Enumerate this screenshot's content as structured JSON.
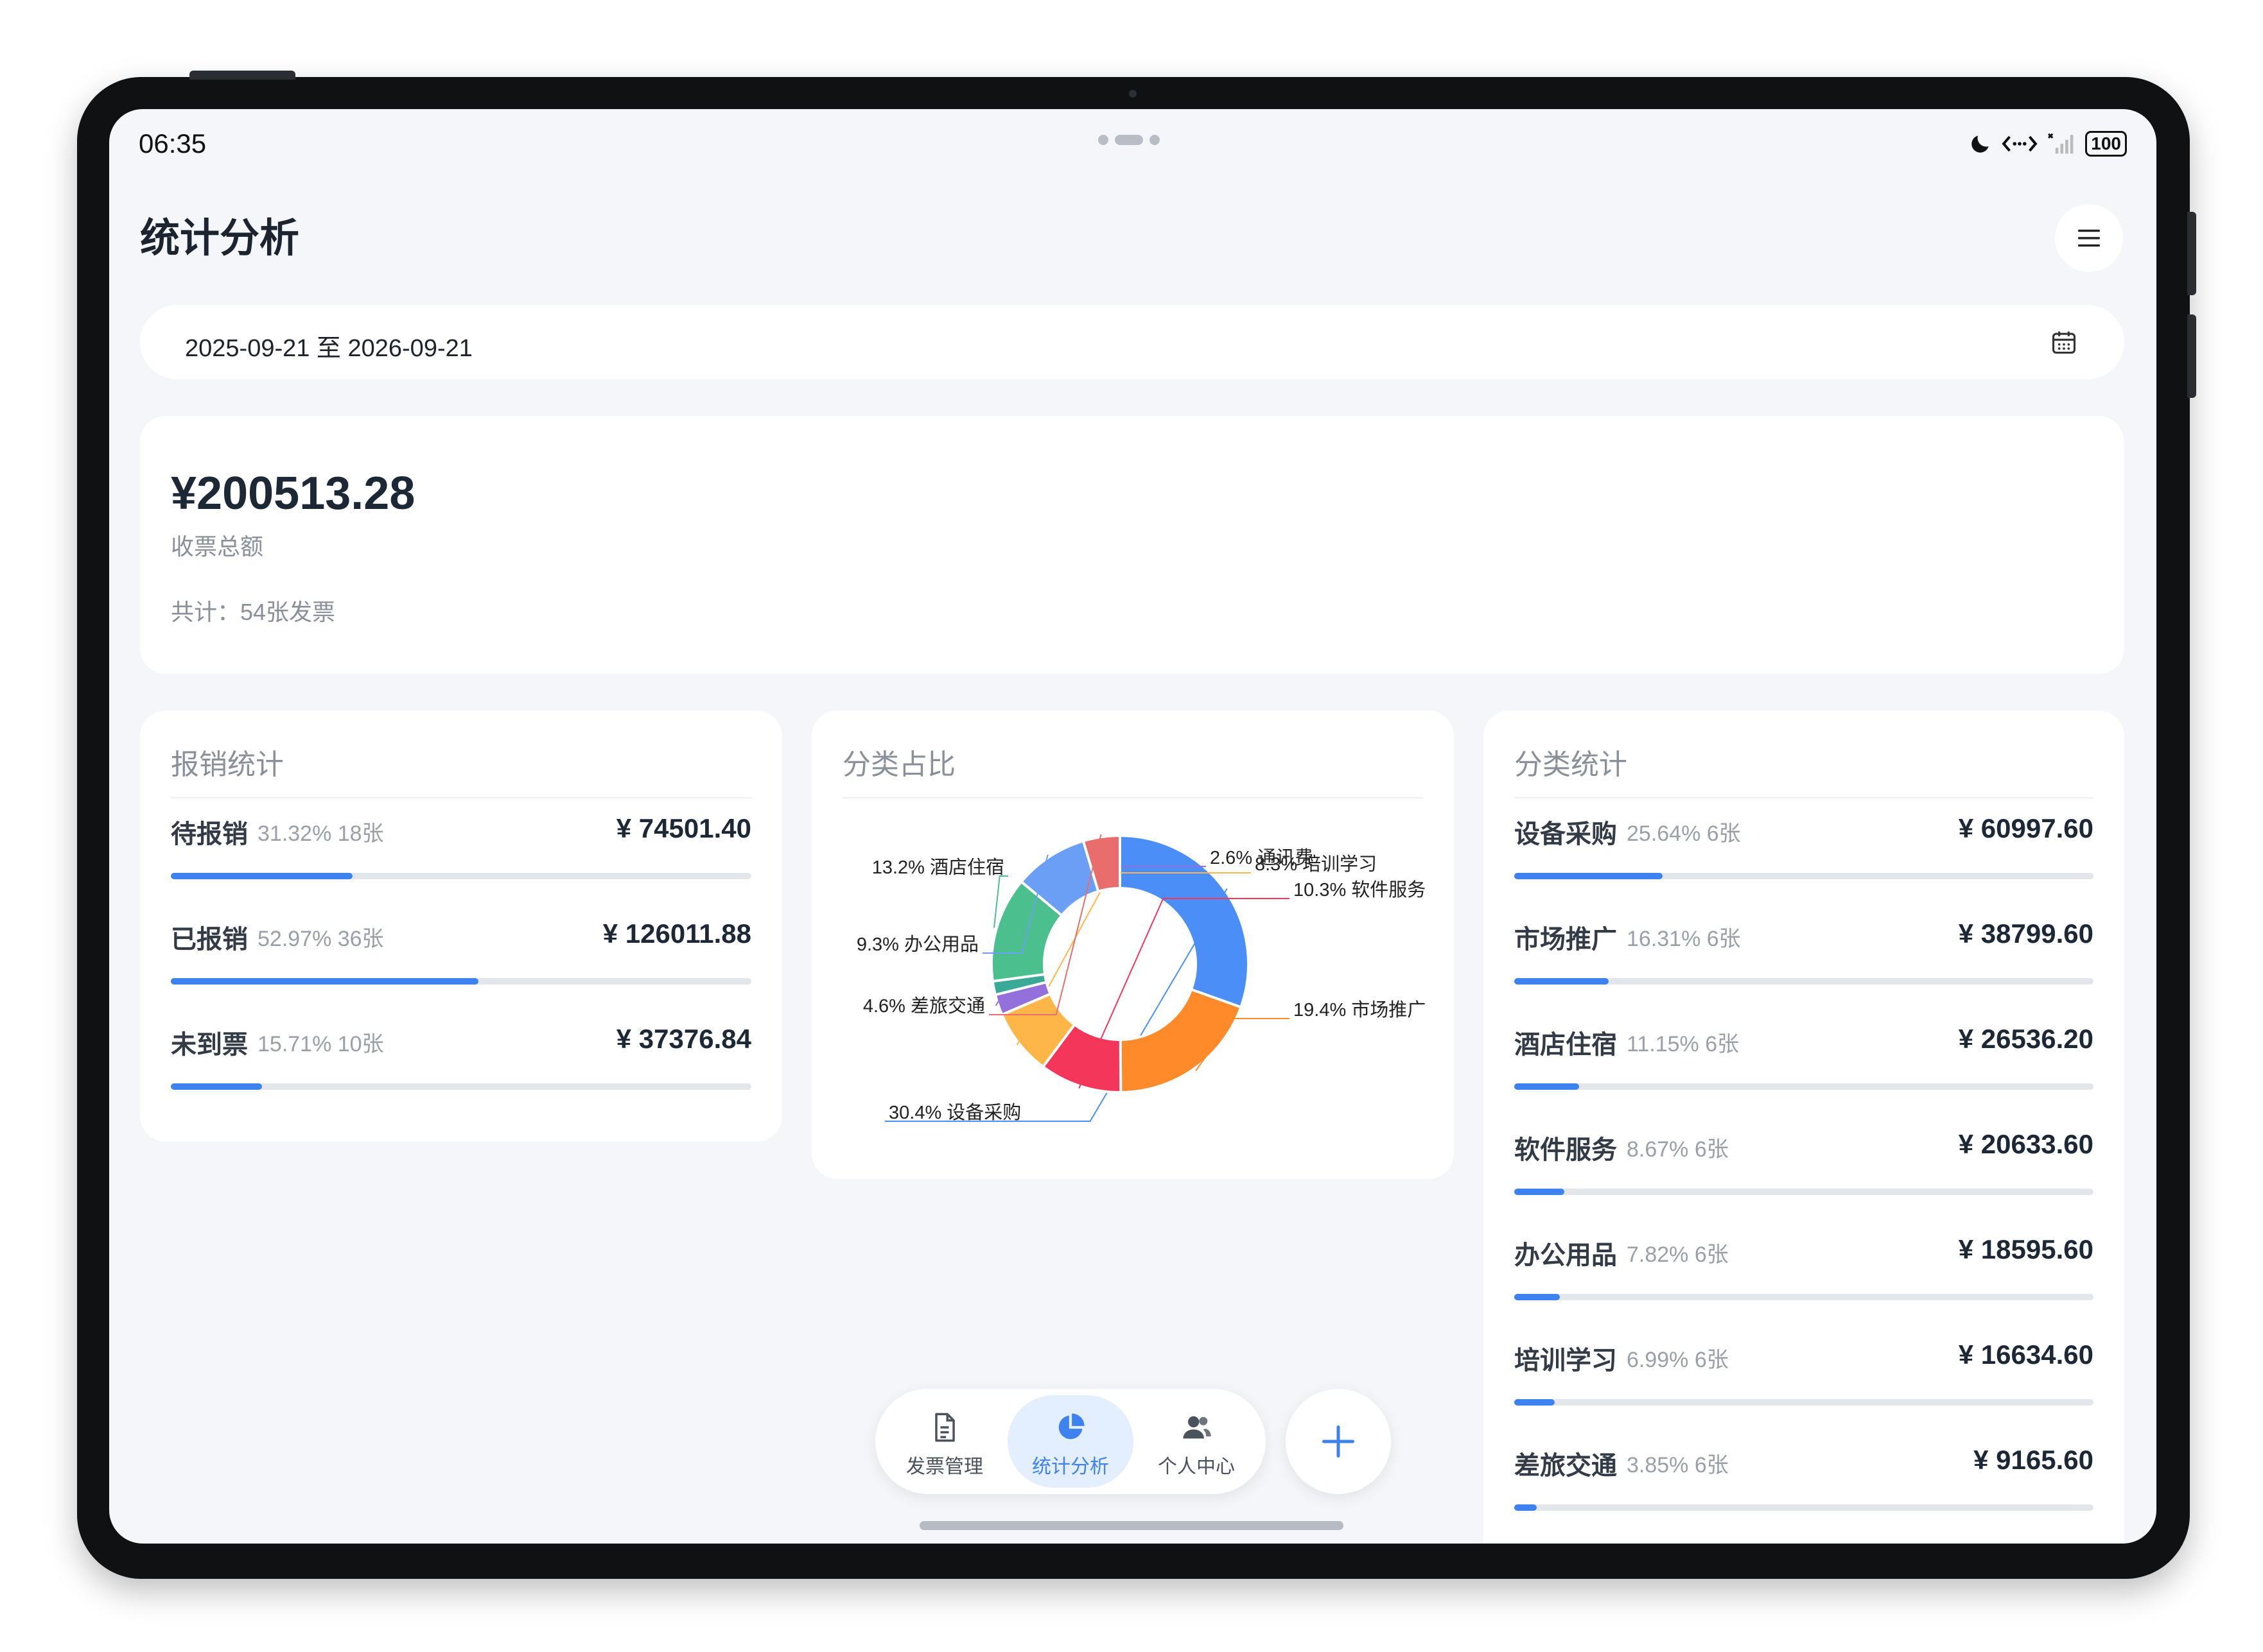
{
  "status_bar": {
    "time": "06:35",
    "battery": "100"
  },
  "page": {
    "title": "统计分析"
  },
  "date_range": {
    "text": "2025-09-21 至 2026-09-21"
  },
  "total": {
    "amount": "¥200513.28",
    "label": "收票总额",
    "count": "共计：54张发票"
  },
  "reimbursement": {
    "title": "报销统计",
    "rows": [
      {
        "name": "待报销",
        "meta": "31.32% 18张",
        "amount": "¥ 74501.40",
        "percent": 31.32
      },
      {
        "name": "已报销",
        "meta": "52.97% 36张",
        "amount": "¥ 126011.88",
        "percent": 52.97
      },
      {
        "name": "未到票",
        "meta": "15.71% 10张",
        "amount": "¥ 37376.84",
        "percent": 15.71
      }
    ]
  },
  "pie": {
    "title": "分类占比",
    "slices": [
      {
        "label": "30.4% 设备采购",
        "value": 30.4,
        "color": "#4c8ef7"
      },
      {
        "label": "19.4% 市场推广",
        "value": 19.4,
        "color": "#ff8a2a"
      },
      {
        "label": "10.3% 软件服务",
        "value": 10.3,
        "color": "#f4365b"
      },
      {
        "label": "8.3% 培训学习",
        "value": 8.3,
        "color": "#ffb648"
      },
      {
        "label": "2.6% 通讯费",
        "value": 2.6,
        "color": "#9370db"
      },
      {
        "label": "",
        "value": 1.7,
        "color": "#3aa997"
      },
      {
        "label": "13.2% 酒店住宿",
        "value": 13.2,
        "color": "#4cbf8e"
      },
      {
        "label": "9.3% 办公用品",
        "value": 9.3,
        "color": "#6b9ff5"
      },
      {
        "label": "4.6% 差旅交通",
        "value": 4.6,
        "color": "#ea6d6d"
      }
    ]
  },
  "categories": {
    "title": "分类统计",
    "rows": [
      {
        "name": "设备采购",
        "meta": "25.64% 6张",
        "amount": "¥ 60997.60",
        "percent": 25.64
      },
      {
        "name": "市场推广",
        "meta": "16.31% 6张",
        "amount": "¥ 38799.60",
        "percent": 16.31
      },
      {
        "name": "酒店住宿",
        "meta": "11.15% 6张",
        "amount": "¥ 26536.20",
        "percent": 11.15
      },
      {
        "name": "软件服务",
        "meta": "8.67% 6张",
        "amount": "¥ 20633.60",
        "percent": 8.67
      },
      {
        "name": "办公用品",
        "meta": "7.82% 6张",
        "amount": "¥ 18595.60",
        "percent": 7.82
      },
      {
        "name": "培训学习",
        "meta": "6.99% 6张",
        "amount": "¥ 16634.60",
        "percent": 6.99
      },
      {
        "name": "差旅交通",
        "meta": "3.85% 6张",
        "amount": "¥ 9165.60",
        "percent": 3.85
      }
    ]
  },
  "nav": {
    "items": [
      {
        "label": "发票管理",
        "icon": "document-icon"
      },
      {
        "label": "统计分析",
        "icon": "pie-chart-icon"
      },
      {
        "label": "个人中心",
        "icon": "users-icon"
      }
    ],
    "active": "统计分析",
    "accent": "#3e82f0"
  }
}
